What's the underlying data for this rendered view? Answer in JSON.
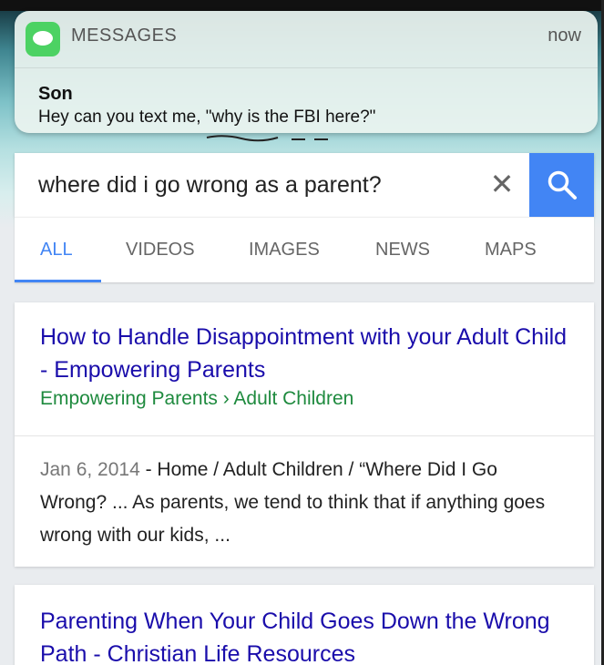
{
  "colors": {
    "accent": "#4285f4",
    "link": "#1a0dab",
    "url": "#1e8a3e",
    "messages_green": "#4cd263"
  },
  "notification": {
    "app_name": "MESSAGES",
    "time": "now",
    "sender": "Son",
    "body": "Hey can you text me, \"why is the FBI here?\"",
    "icon": "messages-icon"
  },
  "search": {
    "query": "where did i go wrong as a parent?",
    "clear_icon": "close-icon",
    "search_icon": "search-icon"
  },
  "tabs": [
    {
      "label": "ALL",
      "active": true
    },
    {
      "label": "VIDEOS",
      "active": false
    },
    {
      "label": "IMAGES",
      "active": false
    },
    {
      "label": "NEWS",
      "active": false
    },
    {
      "label": "MAPS",
      "active": false
    }
  ],
  "results": [
    {
      "title": "How to Handle Disappointment with your Adult Child - Empowering Parents",
      "url": "Empowering Parents › Adult Children",
      "date": "Jan 6, 2014",
      "snippet": " - Home / Adult Children / “Where Did I Go Wrong? ... As parents, we tend to think that if anything goes wrong with our kids, ..."
    },
    {
      "title": "Parenting When Your Child Goes Down the Wrong Path - Christian Life Resources"
    }
  ]
}
